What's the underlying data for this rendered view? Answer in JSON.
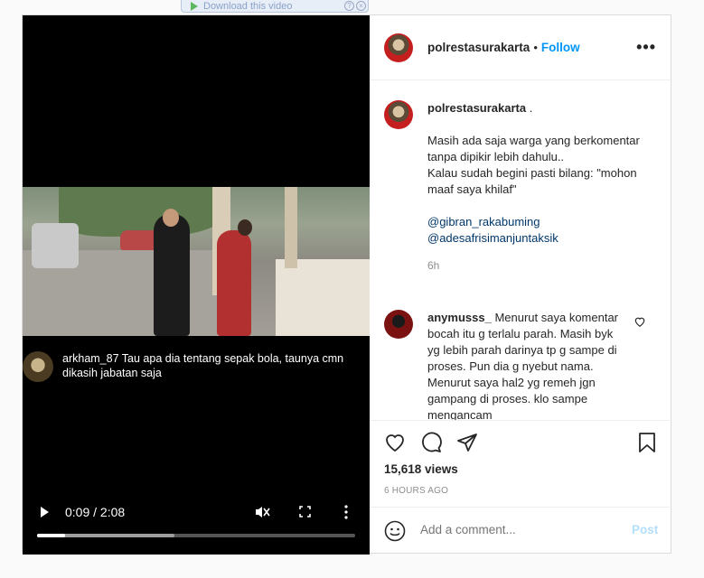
{
  "download_bar": {
    "label": "Download this video"
  },
  "video": {
    "overlay_comment": {
      "user": "arkham_87",
      "text": "Tau apa dia tentang sepak bola, taunya cmn dikasih jabatan saja"
    },
    "time_display": "0:09 / 2:08",
    "progress_fraction": 0.088,
    "buffered_fraction": 0.432
  },
  "header": {
    "username": "polrestasurakarta",
    "separator": "•",
    "follow_label": "Follow",
    "options_label": "•••"
  },
  "caption": {
    "username": "polrestasurakarta",
    "suffix": " .",
    "text": "Masih ada saja warga yang berkomentar tanpa dipikir lebih dahulu..\nKalau sudah begini pasti bilang: \"mohon maaf saya khilaf\"",
    "mention1": "@gibran_rakabuming",
    "mention2": "@adesafrisimanjuntaksik",
    "age": "6h"
  },
  "comment": {
    "username": "anymusss_",
    "text": " Menurut saya komentar bocah itu g terlalu parah. Masih byk yg lebih parah darinya tp g sampe di proses. Pun dia g nyebut nama. Menurut saya hal2 yg remeh jgn gampang di proses. klo sampe mengancam"
  },
  "stats": {
    "views": "15,618 views",
    "posted": "6 HOURS AGO"
  },
  "add_comment": {
    "placeholder": "Add a comment...",
    "post_label": "Post"
  }
}
